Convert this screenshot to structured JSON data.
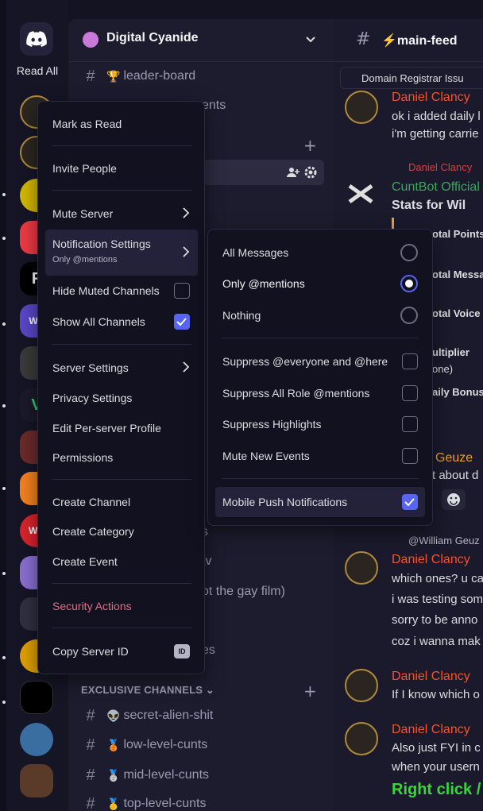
{
  "rail": {
    "read_all": "Read All",
    "servers": [
      {
        "name": "server-1",
        "color": "#2b2620"
      },
      {
        "name": "server-2",
        "color": "#2b2620"
      },
      {
        "name": "server-3",
        "color": "#d4b800"
      },
      {
        "name": "server-4",
        "color": "#ee3a44"
      },
      {
        "name": "server-5",
        "color": "#000000",
        "label": "F"
      },
      {
        "name": "server-6",
        "color": "#5a46c8",
        "label": "WS"
      },
      {
        "name": "server-7",
        "color": "#3a3a3a"
      },
      {
        "name": "server-8",
        "color": "#1a1a2a",
        "label": "V"
      },
      {
        "name": "server-9",
        "color": "#6b2a2a"
      },
      {
        "name": "server-10",
        "color": "#f48120"
      },
      {
        "name": "server-11",
        "color": "#d8242c",
        "label": "WB"
      },
      {
        "name": "server-12",
        "color": "#8a6fd0"
      },
      {
        "name": "server-13",
        "color": "#303040"
      },
      {
        "name": "server-14",
        "color": "#e0a000"
      },
      {
        "name": "server-15",
        "color": "#000000"
      },
      {
        "name": "server-16",
        "color": "#3b6ea0"
      },
      {
        "name": "server-17",
        "color": "#5a3a28"
      }
    ]
  },
  "guild": {
    "name": "Digital Cyanide"
  },
  "channels": {
    "top": [
      {
        "emoji": "🏆",
        "name": "leader-board"
      },
      {
        "emoji": "",
        "name": "ents"
      }
    ],
    "fragments": {
      "f1": "s",
      "f2": "tv",
      "f3": "ot the gay film)",
      "f4": "es"
    },
    "category": "EXCLUSIVE CHANNELS",
    "exclusive": [
      {
        "emoji": "👽",
        "name": "secret-alien-shit"
      },
      {
        "emoji": "🥉",
        "name": "low-level-cunts"
      },
      {
        "emoji": "🥈",
        "name": "mid-level-cunts"
      },
      {
        "emoji": "🥇",
        "name": "top-level-cunts"
      }
    ]
  },
  "chat": {
    "channel": "⚡main-feed",
    "pinned": "Domain Registrar Issu",
    "lines": {
      "u1": "Daniel Clancy",
      "l1": "ok i added daily l",
      "l2": "i'm getting carrie",
      "reply1": "Daniel Clancy",
      "bot": "CuntBot Official",
      "embed_title": "Stats for Wil",
      "e1": "otal Points",
      "e2": "otal Messag",
      "e3": "otal Voice M",
      "e4": "ultiplier",
      "e5": "one)",
      "e6": "aily Bonus",
      "g1": "Geuze",
      "g2": "t about d",
      "reply2": "@William Geuz",
      "u2": "Daniel Clancy",
      "m1": "which ones? u ca",
      "m2": "i was testing som",
      "m3": "sorry to be anno",
      "m4": "coz i wanna mak",
      "u3": "Daniel Clancy",
      "m5": "If I know which o",
      "u4": "Daniel Clancy",
      "m6": "Also just FYI in c",
      "m7": "when your usern",
      "rc": "Right click /"
    }
  },
  "menu": {
    "mark_read": "Mark as Read",
    "invite": "Invite People",
    "mute": "Mute Server",
    "notif": "Notification Settings",
    "notif_sub": "Only @mentions",
    "hide_muted": "Hide Muted Channels",
    "show_all": "Show All Channels",
    "server_settings": "Server Settings",
    "privacy": "Privacy Settings",
    "edit_profile": "Edit Per-server Profile",
    "permissions": "Permissions",
    "create_channel": "Create Channel",
    "create_category": "Create Category",
    "create_event": "Create Event",
    "security": "Security Actions",
    "copy_id": "Copy Server ID",
    "id_badge": "ID"
  },
  "submenu": {
    "all": "All Messages",
    "mentions": "Only @mentions",
    "nothing": "Nothing",
    "suppress_everyone": "Suppress @everyone and @here",
    "suppress_roles": "Suppress All Role @mentions",
    "suppress_highlights": "Suppress Highlights",
    "mute_events": "Mute New Events",
    "mobile_push": "Mobile Push Notifications"
  },
  "colors": {
    "accent": "#5865f2",
    "danger": "#e06c88",
    "username": "#f0542f"
  }
}
